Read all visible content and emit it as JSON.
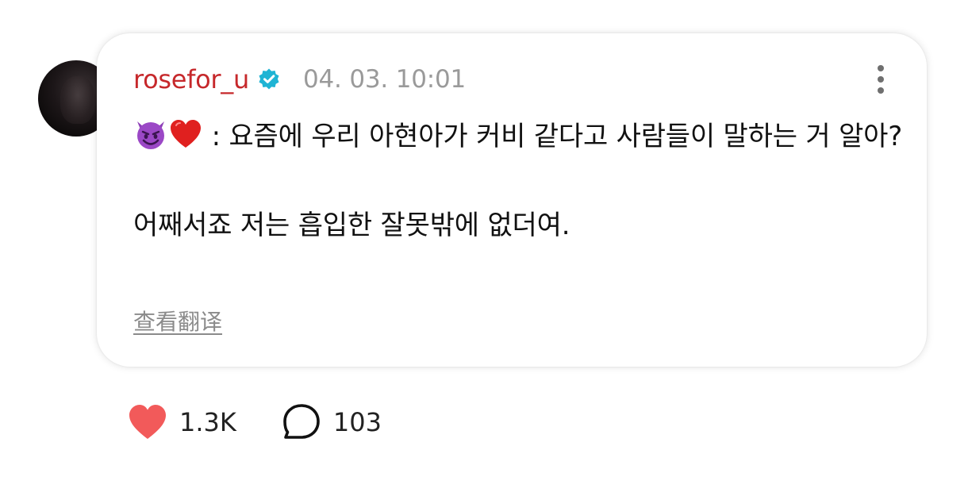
{
  "post": {
    "username": "rosefor_u",
    "timestamp": "04. 03. 10:01",
    "emojis": [
      "smiling-imp",
      "red-heart"
    ],
    "line1_rest": " : 요즘에 우리 아현아가 커비 같다고 사람들이 말하는 거 알아?",
    "paragraph2": "어째서죠 저는 흡입한 잘못밖에 없더여.",
    "translate_label": "查看翻译"
  },
  "stats": {
    "likes": "1.3K",
    "comments": "103"
  },
  "colors": {
    "username": "#c6282b",
    "verified": "#1fb4d4",
    "heart": "#f25a5a",
    "timestamp": "#9a9a9a"
  },
  "icons": {
    "verified": "verified-badge-icon",
    "more": "more-vertical-icon",
    "like": "heart-icon",
    "comment": "comment-bubble-icon"
  }
}
